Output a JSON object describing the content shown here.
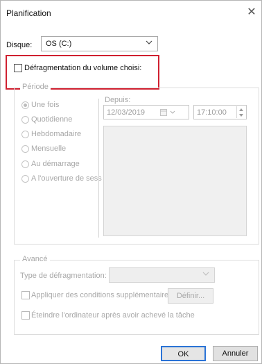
{
  "window": {
    "title": "Planification",
    "close_symbol": "✕"
  },
  "disk": {
    "label": "Disque:",
    "value": "OS (C:)"
  },
  "defrag": {
    "label": "Défragmentation du volume choisi:"
  },
  "period": {
    "legend": "Période",
    "options": [
      {
        "label": "Une fois",
        "selected": true
      },
      {
        "label": "Quotidienne",
        "selected": false
      },
      {
        "label": "Hebdomadaire",
        "selected": false
      },
      {
        "label": "Mensuelle",
        "selected": false
      },
      {
        "label": "Au démarrage",
        "selected": false
      },
      {
        "label": "A l'ouverture de sess",
        "selected": false
      }
    ],
    "since_label": "Depuis:",
    "date": "12/03/2019",
    "time": "17:10:00"
  },
  "advanced": {
    "legend": "Avancé",
    "type_label": "Type de défragmentation:",
    "type_value": "",
    "conditions_label": "Appliquer des conditions supplémentaires:",
    "define_label": "Définir...",
    "shutdown_label": "Éteindre l'ordinateur après avoir achevé la tâche"
  },
  "buttons": {
    "ok": "OK",
    "cancel": "Annuler"
  },
  "colors": {
    "highlight_border": "#d02030",
    "default_button_border": "#2a73d6",
    "disabled_text": "#a8a8a8"
  }
}
